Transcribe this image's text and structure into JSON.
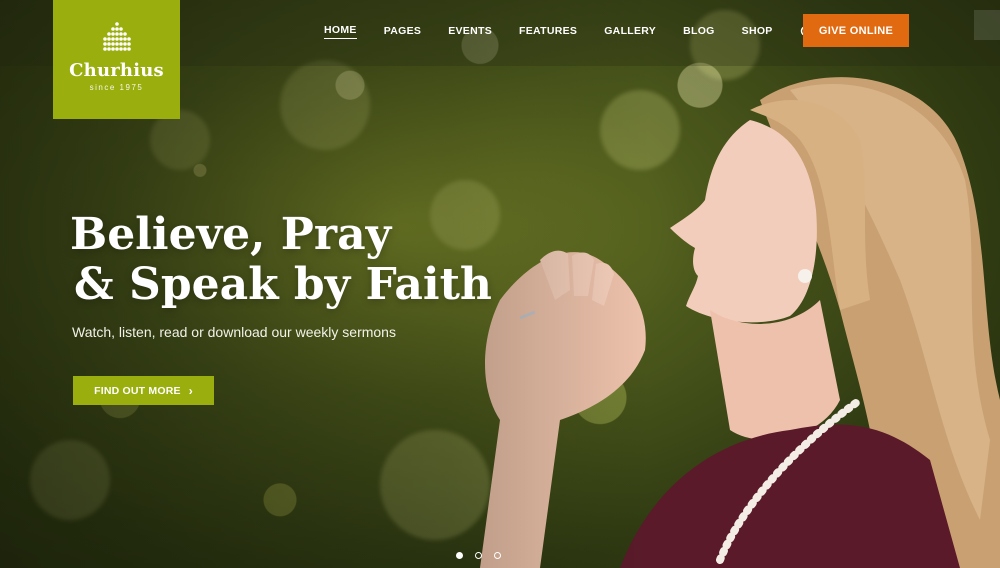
{
  "brand": {
    "name": "Churhius",
    "since": "since 1975",
    "color": "#9aae0d"
  },
  "nav": {
    "items": [
      {
        "label": "HOME",
        "active": true
      },
      {
        "label": "PAGES",
        "active": false
      },
      {
        "label": "EVENTS",
        "active": false
      },
      {
        "label": "FEATURES",
        "active": false
      },
      {
        "label": "GALLERY",
        "active": false
      },
      {
        "label": "BLOG",
        "active": false
      },
      {
        "label": "SHOP",
        "active": false
      }
    ],
    "icons": [
      "search-icon",
      "cart-icon"
    ],
    "give_button": "GIVE ONLINE",
    "give_color": "#e1690f"
  },
  "hero": {
    "title_line1": "Believe, Pray",
    "title_line2": "& Speak by Faith",
    "subtitle": "Watch, listen, read or download our weekly sermons",
    "cta_label": "FIND OUT MORE",
    "cta_icon": "chevron-right-icon"
  },
  "slider": {
    "slide_count": 3,
    "active_index": 0
  }
}
